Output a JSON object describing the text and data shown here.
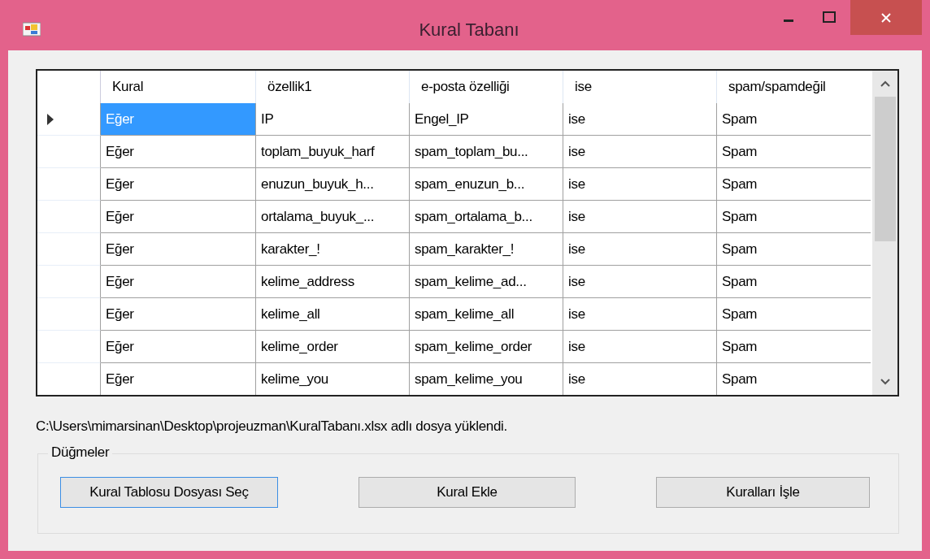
{
  "window": {
    "title": "Kural Tabanı"
  },
  "table": {
    "columns": [
      "Kural",
      "özellik1",
      "e-posta özelliği",
      "ise",
      "spam/spamdeğil"
    ],
    "rows": [
      {
        "current": true,
        "cells": [
          {
            "text": "Eğer",
            "selected": true
          },
          {
            "text": "IP",
            "selected": false
          },
          {
            "text": "Engel_IP",
            "selected": false
          },
          {
            "text": "ise",
            "selected": false
          },
          {
            "text": "Spam",
            "selected": false
          }
        ]
      },
      {
        "current": false,
        "cells": [
          {
            "text": "Eğer",
            "selected": false
          },
          {
            "text": "toplam_buyuk_harf",
            "selected": false
          },
          {
            "text": "spam_toplam_bu...",
            "selected": false
          },
          {
            "text": "ise",
            "selected": false
          },
          {
            "text": "Spam",
            "selected": false
          }
        ]
      },
      {
        "current": false,
        "cells": [
          {
            "text": "Eğer",
            "selected": false
          },
          {
            "text": "enuzun_buyuk_h...",
            "selected": false
          },
          {
            "text": "spam_enuzun_b...",
            "selected": false
          },
          {
            "text": "ise",
            "selected": false
          },
          {
            "text": "Spam",
            "selected": false
          }
        ]
      },
      {
        "current": false,
        "cells": [
          {
            "text": "Eğer",
            "selected": false
          },
          {
            "text": "ortalama_buyuk_...",
            "selected": false
          },
          {
            "text": "spam_ortalama_b...",
            "selected": false
          },
          {
            "text": "ise",
            "selected": false
          },
          {
            "text": "Spam",
            "selected": false
          }
        ]
      },
      {
        "current": false,
        "cells": [
          {
            "text": "Eğer",
            "selected": false
          },
          {
            "text": "karakter_!",
            "selected": false
          },
          {
            "text": "spam_karakter_!",
            "selected": false
          },
          {
            "text": "ise",
            "selected": false
          },
          {
            "text": "Spam",
            "selected": false
          }
        ]
      },
      {
        "current": false,
        "cells": [
          {
            "text": "Eğer",
            "selected": false
          },
          {
            "text": "kelime_address",
            "selected": false
          },
          {
            "text": "spam_kelime_ad...",
            "selected": false
          },
          {
            "text": "ise",
            "selected": false
          },
          {
            "text": "Spam",
            "selected": false
          }
        ]
      },
      {
        "current": false,
        "cells": [
          {
            "text": "Eğer",
            "selected": false
          },
          {
            "text": "kelime_all",
            "selected": false
          },
          {
            "text": "spam_kelime_all",
            "selected": false
          },
          {
            "text": "ise",
            "selected": false
          },
          {
            "text": "Spam",
            "selected": false
          }
        ]
      },
      {
        "current": false,
        "cells": [
          {
            "text": "Eğer",
            "selected": false
          },
          {
            "text": "kelime_order",
            "selected": false
          },
          {
            "text": "spam_kelime_order",
            "selected": false
          },
          {
            "text": "ise",
            "selected": false
          },
          {
            "text": "Spam",
            "selected": false
          }
        ]
      },
      {
        "current": false,
        "cells": [
          {
            "text": "Eğer",
            "selected": false
          },
          {
            "text": "kelime_you",
            "selected": false
          },
          {
            "text": "spam_kelime_you",
            "selected": false
          },
          {
            "text": "ise",
            "selected": false
          },
          {
            "text": "Spam",
            "selected": false
          }
        ]
      }
    ]
  },
  "status": "C:\\Users\\mimarsinan\\Desktop\\projeuzman\\KuralTabanı.xlsx adlı dosya yüklendi.",
  "group": {
    "legend": "Düğmeler",
    "buttons": [
      {
        "label": "Kural Tablosu Dosyası Seç",
        "focused": true
      },
      {
        "label": "Kural Ekle",
        "focused": false
      },
      {
        "label": "Kuralları İşle",
        "focused": false
      }
    ]
  }
}
